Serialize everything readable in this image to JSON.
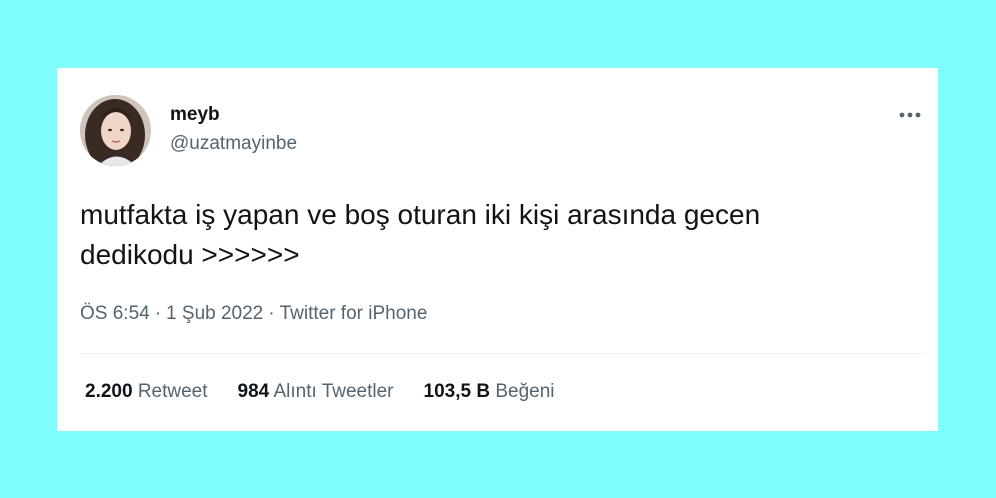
{
  "tweet": {
    "author": {
      "display_name": "meyb",
      "handle": "@uzatmayinbe",
      "avatar_icon": "profile-photo"
    },
    "more_icon": "more-horizontal-icon",
    "text": "mutfakta iş yapan ve boş oturan iki kişi arasında gecen\ndedikodu >>>>>>",
    "meta": {
      "time": "ÖS 6:54",
      "date": "1 Şub 2022",
      "separator": "·",
      "source": "Twitter for iPhone"
    },
    "stats": {
      "retweets_count": "2.200",
      "retweets_label": "Retweet",
      "quotes_count": "984",
      "quotes_label": "Alıntı Tweetler",
      "likes_count": "103,5 B",
      "likes_label": "Beğeni"
    }
  },
  "colors": {
    "background": "#80fdfe",
    "card": "#ffffff",
    "text_primary": "#0f1419",
    "text_secondary": "#536471"
  }
}
